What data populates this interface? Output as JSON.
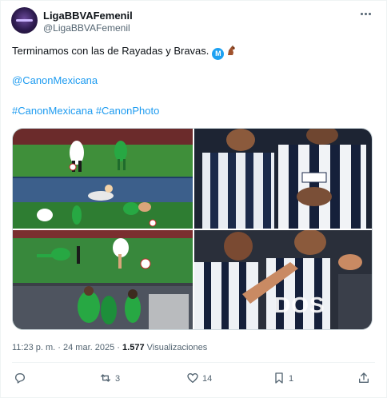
{
  "author": {
    "display_name": "LigaBBVAFemenil",
    "handle": "@LigaBBVAFemenil",
    "avatar_icon": "liga-bbva-femenil-logo-icon"
  },
  "tweet": {
    "text": "Terminamos con las de Rayadas y Bravas.",
    "emoji_badge": "M",
    "mention": "@CanonMexicana",
    "hashtags": [
      "#CanonMexicana",
      "#CanonPhoto"
    ]
  },
  "media": {
    "photos": [
      {
        "subject": "soccer-action-photo"
      },
      {
        "subject": "players-celebrating-photo"
      },
      {
        "subject": "soccer-action-photo"
      },
      {
        "subject": "players-shouting-photo"
      }
    ],
    "overlay_text": "DOS"
  },
  "meta": {
    "time": "11:23 p. m.",
    "separator": "·",
    "date": "24 mar. 2025",
    "views_count": "1.577",
    "views_label": "Visualizaciones"
  },
  "actions": {
    "reply_icon": "reply-icon",
    "retweet_count": "3",
    "like_count": "14",
    "bookmark_count": "1",
    "share_icon": "share-icon"
  },
  "colors": {
    "link": "#1d9bf0",
    "secondary_text": "#536471",
    "primary_text": "#0f1419",
    "border": "#cfd9de"
  }
}
